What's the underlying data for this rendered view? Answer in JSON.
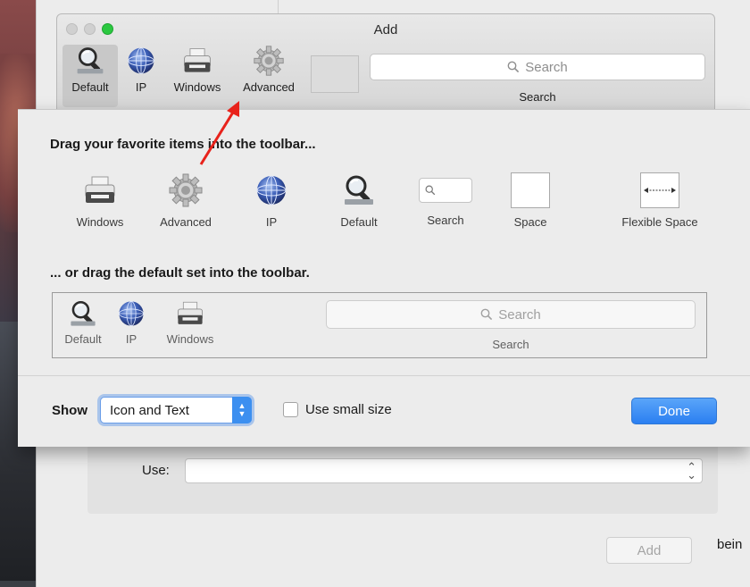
{
  "window": {
    "title": "Add"
  },
  "toolbar": {
    "items": [
      {
        "label": "Default",
        "icon": "magnifier-icon",
        "selected": true
      },
      {
        "label": "IP",
        "icon": "globe-icon"
      },
      {
        "label": "Windows",
        "icon": "printer-icon"
      },
      {
        "label": "Advanced",
        "icon": "gear-icon"
      }
    ],
    "search_placeholder": "Search",
    "search_label": "Search"
  },
  "customize": {
    "heading": "Drag your favorite items into the toolbar...",
    "palette": [
      {
        "label": "Windows",
        "icon": "printer-icon"
      },
      {
        "label": "Advanced",
        "icon": "gear-icon"
      },
      {
        "label": "IP",
        "icon": "globe-icon"
      },
      {
        "label": "Default",
        "icon": "magnifier-icon"
      },
      {
        "label": "Search",
        "icon": "search-field-icon"
      },
      {
        "label": "Space",
        "icon": "space-icon"
      },
      {
        "label": "Flexible Space",
        "icon": "flexible-space-icon"
      }
    ],
    "default_heading": "... or drag the default set into the toolbar.",
    "default_set": {
      "items": [
        {
          "label": "Default",
          "icon": "magnifier-icon"
        },
        {
          "label": "IP",
          "icon": "globe-icon"
        },
        {
          "label": "Windows",
          "icon": "printer-icon"
        }
      ],
      "search_placeholder": "Search",
      "search_label": "Search"
    },
    "show_label": "Show",
    "show_value": "Icon and Text",
    "small_size_label": "Use small size",
    "small_size_checked": false,
    "done_label": "Done"
  },
  "background": {
    "use_label": "Use:",
    "use_value": "",
    "add_button": "Add",
    "trailing_text": "bein"
  },
  "colors": {
    "accent": "#2b7ff1",
    "annotation": "#e8221b",
    "traffic_green": "#2bc840"
  }
}
